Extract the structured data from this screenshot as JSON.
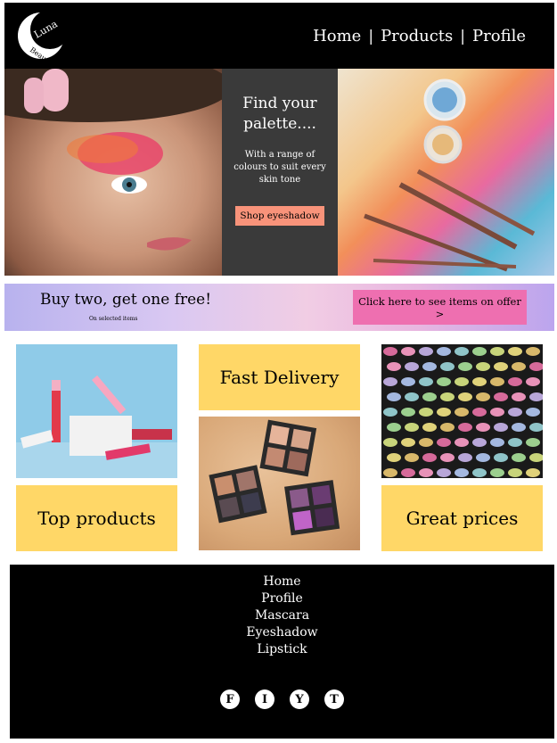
{
  "brand": {
    "logo_line1": "Luna",
    "logo_line2": "Beauty"
  },
  "nav": {
    "home": "Home",
    "products": "Products",
    "profile": "Profile",
    "separator": "|"
  },
  "hero": {
    "title": "Find your palette....",
    "subtitle": "With a range of colours to suit every skin tone",
    "button": "Shop eyeshadow"
  },
  "promo": {
    "title": "Buy two, get one free!",
    "subtitle": "On selected items",
    "button": "Click here to see items on offer >"
  },
  "tiles": {
    "top_products": "Top products",
    "fast_delivery": "Fast Delivery",
    "great_prices": "Great prices"
  },
  "footer": {
    "links": [
      "Home",
      "Profile",
      "Mascara",
      "Eyeshadow",
      "Lipstick"
    ],
    "social": [
      "F",
      "I",
      "Y",
      "T"
    ]
  },
  "colors": {
    "header_bg": "#000000",
    "hero_panel": "#3a3a3a",
    "shop_button": "#f8937a",
    "promo_button": "#ee6fb0",
    "tile_yellow": "#ffd767"
  }
}
